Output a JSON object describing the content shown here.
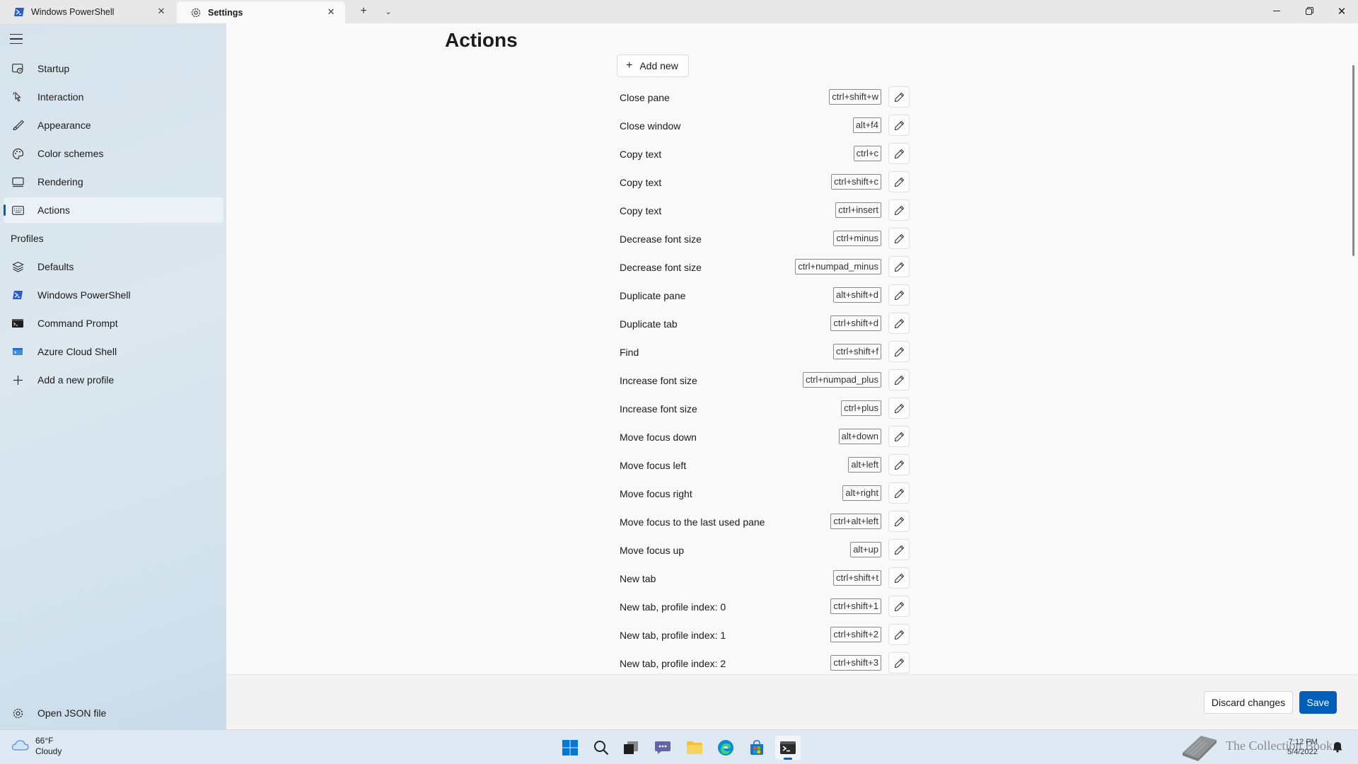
{
  "tabs": [
    {
      "title": "Windows PowerShell",
      "icon": "powershell-icon"
    },
    {
      "title": "Settings",
      "icon": "gear-icon",
      "active": true
    }
  ],
  "sidebar": {
    "items": [
      {
        "label": "Startup",
        "icon": "startup-icon"
      },
      {
        "label": "Interaction",
        "icon": "interaction-icon"
      },
      {
        "label": "Appearance",
        "icon": "brush-icon"
      },
      {
        "label": "Color schemes",
        "icon": "palette-icon"
      },
      {
        "label": "Rendering",
        "icon": "monitor-icon"
      },
      {
        "label": "Actions",
        "icon": "keyboard-icon",
        "selected": true
      }
    ],
    "profiles_header": "Profiles",
    "profiles": [
      {
        "label": "Defaults",
        "icon": "layers-icon"
      },
      {
        "label": "Windows PowerShell",
        "icon": "powershell-icon"
      },
      {
        "label": "Command Prompt",
        "icon": "cmd-icon"
      },
      {
        "label": "Azure Cloud Shell",
        "icon": "azure-icon"
      },
      {
        "label": "Add a new profile",
        "icon": "plus-icon"
      }
    ],
    "open_json": "Open JSON file"
  },
  "main": {
    "title": "Actions",
    "add_new": "Add new",
    "actions": [
      {
        "name": "Close pane",
        "keys": "ctrl+shift+w"
      },
      {
        "name": "Close window",
        "keys": "alt+f4"
      },
      {
        "name": "Copy text",
        "keys": "ctrl+c"
      },
      {
        "name": "Copy text",
        "keys": "ctrl+shift+c"
      },
      {
        "name": "Copy text",
        "keys": "ctrl+insert"
      },
      {
        "name": "Decrease font size",
        "keys": "ctrl+minus"
      },
      {
        "name": "Decrease font size",
        "keys": "ctrl+numpad_minus"
      },
      {
        "name": "Duplicate pane",
        "keys": "alt+shift+d"
      },
      {
        "name": "Duplicate tab",
        "keys": "ctrl+shift+d"
      },
      {
        "name": "Find",
        "keys": "ctrl+shift+f"
      },
      {
        "name": "Increase font size",
        "keys": "ctrl+numpad_plus"
      },
      {
        "name": "Increase font size",
        "keys": "ctrl+plus"
      },
      {
        "name": "Move focus down",
        "keys": "alt+down"
      },
      {
        "name": "Move focus left",
        "keys": "alt+left"
      },
      {
        "name": "Move focus right",
        "keys": "alt+right"
      },
      {
        "name": "Move focus to the last used pane",
        "keys": "ctrl+alt+left"
      },
      {
        "name": "Move focus up",
        "keys": "alt+up"
      },
      {
        "name": "New tab",
        "keys": "ctrl+shift+t"
      },
      {
        "name": "New tab, profile index: 0",
        "keys": "ctrl+shift+1"
      },
      {
        "name": "New tab, profile index: 1",
        "keys": "ctrl+shift+2"
      },
      {
        "name": "New tab, profile index: 2",
        "keys": "ctrl+shift+3"
      }
    ]
  },
  "footer": {
    "discard": "Discard changes",
    "save": "Save"
  },
  "taskbar": {
    "weather_temp": "66°F",
    "weather_desc": "Cloudy",
    "apps": [
      "start-icon",
      "search-icon",
      "task-view-icon",
      "chat-icon",
      "file-explorer-icon",
      "edge-icon",
      "store-icon",
      "terminal-icon"
    ],
    "time": "7:12 PM",
    "date": "5/4/2022",
    "watermark": "The Collection Book"
  },
  "colors": {
    "accent": "#005fb8",
    "sidebar_bg": "#d7e3ec",
    "content_bg": "#f9f9f9"
  }
}
